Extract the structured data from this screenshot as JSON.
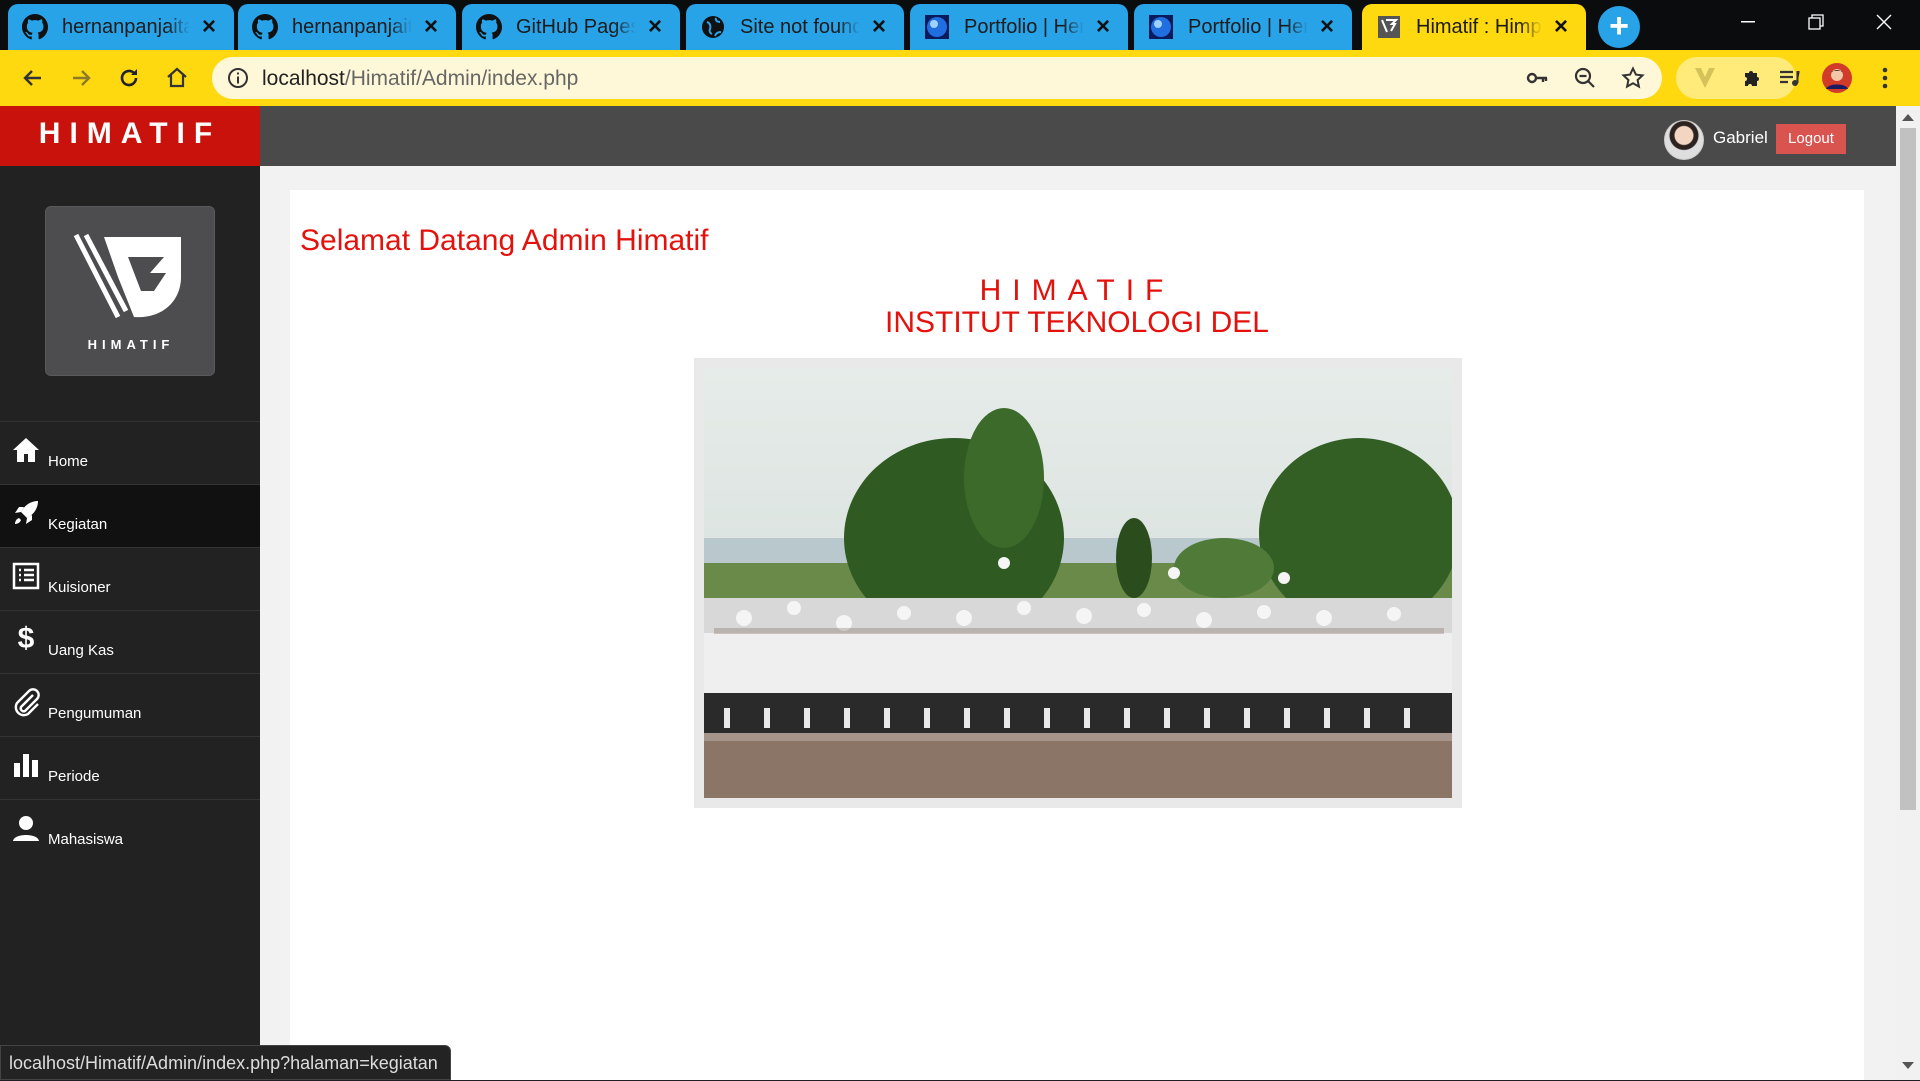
{
  "browser": {
    "tabs": [
      {
        "title": "hernanpanjaitan",
        "icon": "github-icon",
        "active": false
      },
      {
        "title": "hernanpanjaitan",
        "icon": "github-icon",
        "active": false
      },
      {
        "title": "GitHub Pages | W",
        "icon": "github-icon",
        "active": false
      },
      {
        "title": "Site not found · G",
        "icon": "globe-icon",
        "active": false
      },
      {
        "title": "Portfolio | Hernan",
        "icon": "blue-orb-icon",
        "active": false
      },
      {
        "title": "Portfolio | Hernan",
        "icon": "blue-orb-icon",
        "active": false
      },
      {
        "title": "Himatif : Himpunan",
        "icon": "himatif-favicon",
        "active": true
      }
    ],
    "address": {
      "host": "localhost",
      "path": "/Himatif/Admin/index.php"
    },
    "status_url": "localhost/Himatif/Admin/index.php?halaman=kegiatan",
    "colors": {
      "tab_bg": "#29a3e8",
      "active_tab_bg": "#ffd90f",
      "toolbar_bg": "#ffd90f"
    }
  },
  "app": {
    "brand": "HIMATIF",
    "logo_text": "HIMATIF",
    "user": {
      "name": "Gabriel",
      "logout_label": "Logout"
    },
    "menu": [
      {
        "label": "Home",
        "icon": "home-icon"
      },
      {
        "label": "Kegiatan",
        "icon": "rocket-icon",
        "active": true
      },
      {
        "label": "Kuisioner",
        "icon": "list-icon"
      },
      {
        "label": "Uang Kas",
        "icon": "dollar-icon"
      },
      {
        "label": "Pengumuman",
        "icon": "paperclip-icon"
      },
      {
        "label": "Periode",
        "icon": "bar-chart-icon"
      },
      {
        "label": "Mahasiswa",
        "icon": "user-icon"
      }
    ],
    "content": {
      "welcome": "Selamat Datang Admin Himatif",
      "org_name": "HIMATIF",
      "institution": "INSTITUT TEKNOLOGI DEL"
    },
    "colors": {
      "brand_red": "#c9120b",
      "heading_red": "#e3120c",
      "sidebar_bg": "#222222",
      "topbar_bg": "#4a4a4a",
      "logout_bg": "#d9534f"
    }
  }
}
